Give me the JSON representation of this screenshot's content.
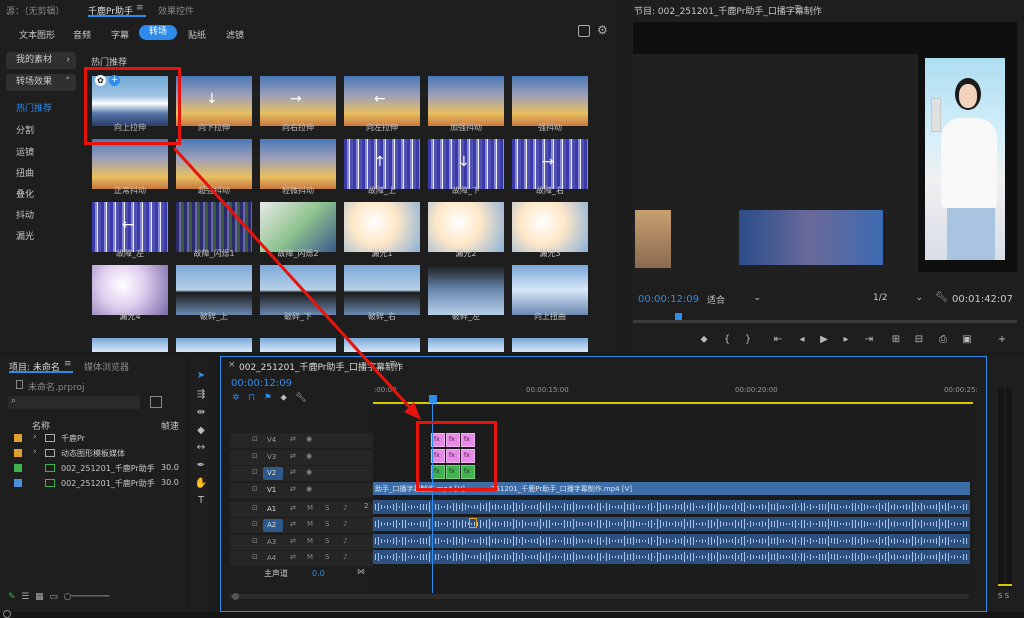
{
  "plugin": {
    "tabs": [
      "源：（无剪辑）",
      "千鹿Pr助手",
      "效果控件"
    ],
    "categories": [
      "文本图形",
      "音频",
      "字幕",
      "转场",
      "贴纸",
      "滤镜"
    ],
    "side_items": [
      "我的素材",
      "转场效果",
      "热门推荐",
      "分割",
      "运镜",
      "扭曲",
      "叠化",
      "抖动",
      "漏光"
    ],
    "section_title": "热门推荐",
    "thumbs": [
      "向上拉伸",
      "向下拉伸",
      "向右拉伸",
      "向左拉伸",
      "加强抖动",
      "强抖动",
      "正常抖动",
      "超强抖动",
      "轻微抖动",
      "故障_上",
      "故障_下",
      "故障_右",
      "故障_左",
      "故障_闪烁1",
      "故障_闪烁2",
      "漏光1",
      "漏光2",
      "漏光3",
      "漏光4",
      "破碎_上",
      "破碎_下",
      "破碎_右",
      "破碎_左",
      "向上扭曲"
    ]
  },
  "program": {
    "title": "节目: 002_251201_千鹿Pr助手_口播字幕制作",
    "timecode": "00:00:12:09",
    "fit": "适合",
    "quality": "1/2",
    "duration": "00:01:42:07"
  },
  "project": {
    "tabs": [
      "项目: 未命名",
      "媒体浏览器"
    ],
    "file": "未命名.prproj",
    "col_name": "名称",
    "col_rate": "帧速",
    "rows": [
      {
        "name": "千鹿Pr",
        "rate": "",
        "color": "#e0a030"
      },
      {
        "name": "动态图形模板媒体",
        "rate": "",
        "color": "#e0a030"
      },
      {
        "name": "002_251201_千鹿Pr助手",
        "rate": "30.0",
        "color": "#3cb44b"
      },
      {
        "name": "002_251201_千鹿Pr助手",
        "rate": "30.0",
        "color": "#4a8fd8"
      }
    ]
  },
  "timeline": {
    "title": "002_251201_千鹿Pr助手_口播字幕制作",
    "timecode": "00:00:12:09",
    "ruler": [
      ":00:00",
      "00:00:15:00",
      "00:00:20:00",
      "00:00:25:"
    ],
    "video_tracks": [
      "V4",
      "V3",
      "V2",
      "V1"
    ],
    "audio_tracks": [
      "A1",
      "A2",
      "A3",
      "A4"
    ],
    "master_label": "主声道",
    "master_value": "0.0",
    "clip_label": "助手_口播字幕制作.mp4 [V]",
    "clip_label2": "251201_千鹿Pr助手_口播字幕制作.mp4 [V]",
    "pink_label": "fx",
    "audio_marker": "2"
  },
  "meter": {
    "label": "S S"
  },
  "colors": {
    "accent": "#2d8ceb",
    "highlight": "#e8140c",
    "pink": "#e88ae8",
    "green": "#3cb44b",
    "clip": "#3d6ea8"
  }
}
